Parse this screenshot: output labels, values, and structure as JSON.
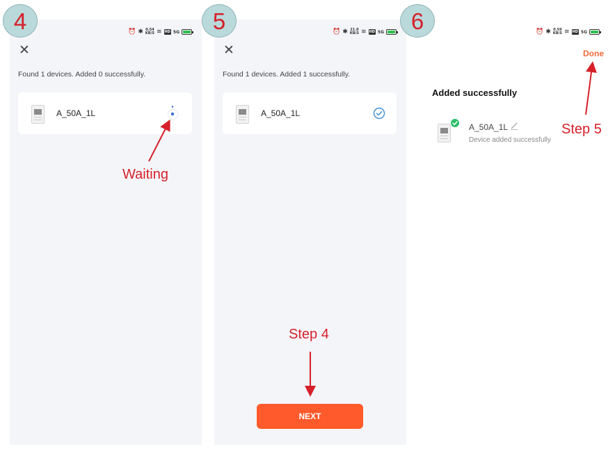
{
  "badges": {
    "step_a": "4",
    "step_b": "5",
    "step_c": "6"
  },
  "status_bar": [
    {
      "speed_top": "0.54",
      "speed_unit": "KB/S",
      "hd": "HD",
      "signal": "5G"
    },
    {
      "speed_top": "21.0",
      "speed_unit": "KB/S",
      "hd": "HD",
      "signal": "5G"
    },
    {
      "speed_top": "0.59",
      "speed_unit": "KB/S",
      "hd": "HD",
      "signal": "5G"
    }
  ],
  "screen1": {
    "found_text": "Found 1 devices. Added 0 successfully.",
    "device_name": "A_50A_1L",
    "status": "waiting"
  },
  "screen2": {
    "found_text": "Found 1 devices. Added 1 successfully.",
    "device_name": "A_50A_1L",
    "status": "added",
    "next_label": "NEXT"
  },
  "screen3": {
    "done_label": "Done",
    "title": "Added successfully",
    "device_name": "A_50A_1L",
    "device_sub": "Device added successfully"
  },
  "annotations": {
    "waiting": "Waiting",
    "step4": "Step 4",
    "step5": "Step 5"
  },
  "colors": {
    "accent": "#ff5a2b",
    "annotation_red": "#d6202a",
    "check_blue": "#3b8fd9",
    "success_green": "#2fbf6a",
    "badge_fill": "#b9d9da"
  },
  "icons": {
    "close": "close-icon",
    "check": "check-circle-icon",
    "edit": "edit-icon",
    "device": "meter-device-icon"
  }
}
